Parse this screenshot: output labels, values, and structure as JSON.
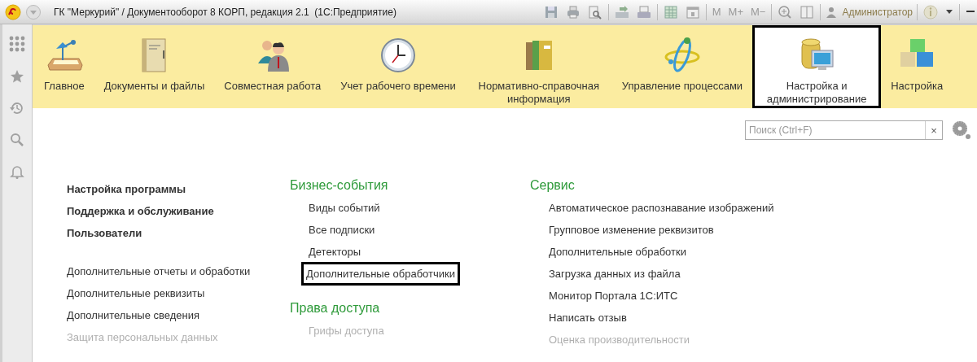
{
  "title_bar": {
    "title": "ГК \"Меркурий\" / Документооборот 8 КОРП, редакция 2.1  (1С:Предприятие)",
    "memory_buttons": [
      "M",
      "M+",
      "M−"
    ],
    "user": "Администратор"
  },
  "sections": [
    {
      "label": "Главное",
      "selected": false
    },
    {
      "label": "Документы и файлы",
      "selected": false
    },
    {
      "label": "Совместная работа",
      "selected": false
    },
    {
      "label": "Учет рабочего времени",
      "selected": false
    },
    {
      "label": "Нормативно-справочная информация",
      "selected": false
    },
    {
      "label": "Управление процессами",
      "selected": false
    },
    {
      "label": "Настройка и администрирование",
      "selected": true
    },
    {
      "label": "Настройка",
      "selected": false
    }
  ],
  "search": {
    "placeholder": "Поиск (Ctrl+F)",
    "clear": "×"
  },
  "columns": [
    {
      "groups": [
        {
          "items": [
            {
              "label": "Настройка программы",
              "bold": true,
              "selected": false,
              "faded": false
            },
            {
              "label": "Поддержка и обслуживание",
              "bold": true,
              "selected": false,
              "faded": false
            },
            {
              "label": "Пользователи",
              "bold": true,
              "selected": false,
              "faded": false
            }
          ]
        },
        {
          "items": [
            {
              "label": "Дополнительные отчеты и обработки",
              "bold": false,
              "selected": false,
              "faded": false
            },
            {
              "label": "Дополнительные реквизиты",
              "bold": false,
              "selected": false,
              "faded": false
            },
            {
              "label": "Дополнительные сведения",
              "bold": false,
              "selected": false,
              "faded": false
            },
            {
              "label": "Защита персональных данных",
              "bold": false,
              "selected": false,
              "faded": true
            }
          ]
        }
      ]
    },
    {
      "groups": [
        {
          "heading": "Бизнес-события",
          "items": [
            {
              "label": "Виды событий",
              "bold": false,
              "selected": false,
              "faded": false
            },
            {
              "label": "Все подписки",
              "bold": false,
              "selected": false,
              "faded": false
            },
            {
              "label": "Детекторы",
              "bold": false,
              "selected": false,
              "faded": false
            },
            {
              "label": "Дополнительные обработчики",
              "bold": false,
              "selected": true,
              "faded": false
            }
          ]
        },
        {
          "heading": "Права доступа",
          "items": [
            {
              "label": "Грифы доступа",
              "bold": false,
              "selected": false,
              "faded": true
            }
          ]
        }
      ]
    },
    {
      "groups": [
        {
          "heading": "Сервис",
          "items": [
            {
              "label": "Автоматическое распознавание изображений",
              "bold": false,
              "selected": false,
              "faded": false
            },
            {
              "label": "Групповое изменение реквизитов",
              "bold": false,
              "selected": false,
              "faded": false
            },
            {
              "label": "Дополнительные обработки",
              "bold": false,
              "selected": false,
              "faded": false
            },
            {
              "label": "Загрузка данных из файла",
              "bold": false,
              "selected": false,
              "faded": false
            },
            {
              "label": "Монитор Портала 1С:ИТС",
              "bold": false,
              "selected": false,
              "faded": false
            },
            {
              "label": "Написать отзыв",
              "bold": false,
              "selected": false,
              "faded": false
            },
            {
              "label": "Оценка производительности",
              "bold": false,
              "selected": false,
              "faded": true
            }
          ]
        }
      ]
    }
  ]
}
